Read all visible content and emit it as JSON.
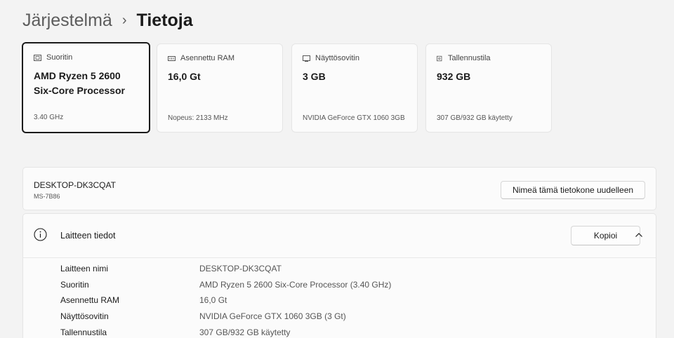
{
  "breadcrumb": {
    "parent": "Järjestelmä",
    "separator": "›",
    "current": "Tietoja"
  },
  "cards": [
    {
      "icon": "cpu-icon",
      "label": "Suoritin",
      "value_line1": "AMD Ryzen 5 2600",
      "value_line2": "Six-Core Processor",
      "sub": "3.40 GHz",
      "selected": true
    },
    {
      "icon": "ram-icon",
      "label": "Asennettu RAM",
      "value_line1": "16,0 Gt",
      "value_line2": "",
      "sub": "Nopeus: 2133 MHz",
      "selected": false
    },
    {
      "icon": "gpu-icon",
      "label": "Näyttösovitin",
      "value_line1": "3 GB",
      "value_line2": "",
      "sub": "NVIDIA GeForce GTX 1060 3GB",
      "selected": false
    },
    {
      "icon": "storage-icon",
      "label": "Tallennustila",
      "value_line1": "932 GB",
      "value_line2": "",
      "sub": "307 GB/932 GB käytetty",
      "selected": false
    }
  ],
  "pc": {
    "name": "DESKTOP-DK3CQAT",
    "model": "MS-7B86",
    "rename_label": "Nimeä tämä tietokone uudelleen"
  },
  "device_specs": {
    "icon": "info-icon",
    "title": "Laitteen tiedot",
    "copy_label": "Kopioi",
    "expanded": true,
    "rows": [
      {
        "key": "Laitteen nimi",
        "value": "DESKTOP-DK3CQAT"
      },
      {
        "key": "Suoritin",
        "value": "AMD Ryzen 5 2600 Six-Core Processor (3.40 GHz)"
      },
      {
        "key": "Asennettu RAM",
        "value": "16,0 Gt"
      },
      {
        "key": "Näyttösovitin",
        "value": "NVIDIA GeForce GTX 1060 3GB (3 Gt)"
      },
      {
        "key": "Tallennustila",
        "value": "307 GB/932 GB käytetty"
      }
    ]
  },
  "colors": {
    "background": "#f3f3f3",
    "card": "#fbfbfb",
    "selected_border": "#1b1b1b"
  }
}
